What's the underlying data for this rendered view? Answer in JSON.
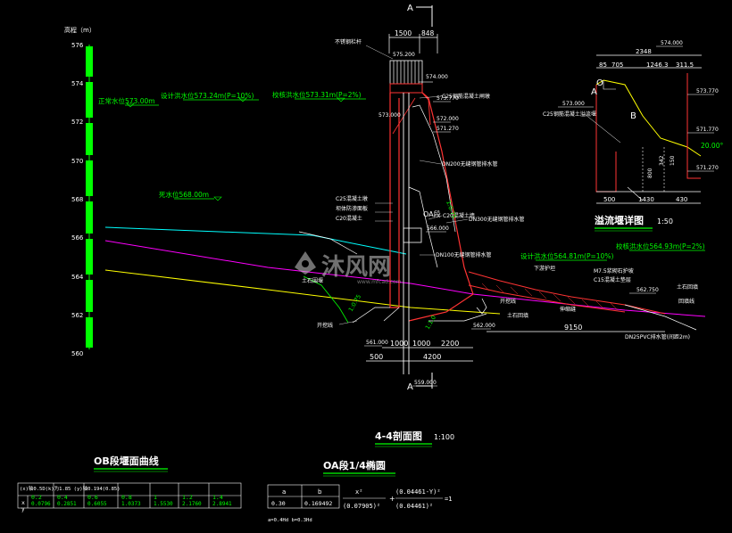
{
  "section_marks": {
    "top": "A",
    "bottom": "A"
  },
  "elevation_scale": {
    "title": "高程（m）",
    "ticks": [
      "576",
      "574",
      "572",
      "570",
      "568",
      "566",
      "564",
      "562",
      "560"
    ]
  },
  "water_levels": {
    "normal": "正常水位573.00m",
    "design": "设计洪水位573.24m(P=10%)",
    "check": "校核洪水位573.31m(P=2%)",
    "dead": "死水位568.00m",
    "design_right": "设计洪水位564.81m(P=10%)",
    "check_right": "校核洪水位564.93m(P=2%)"
  },
  "main_dims": {
    "top_a": "1500",
    "top_b": "848",
    "bottom_a": "1000",
    "bottom_b": "1000",
    "bottom_c": "2200",
    "bottom_d": "500",
    "bottom_e": "4200",
    "bottom_f": "9150"
  },
  "elevations": {
    "e575": "575.200",
    "e574": "574.000",
    "e573a": "573.000",
    "e573b": "573.770",
    "e572": "572.000",
    "e571": "571.270",
    "e566": "566.000",
    "e562a": "562.000",
    "e562b": "562.750",
    "e561": "561.000",
    "e559": "559.000"
  },
  "annotations": {
    "a1": "不锈钢栏杆",
    "a2": "C25钢筋混凝土闸墩",
    "a3": "DN200无缝钢管排水管",
    "a4": "C25混凝土墩",
    "a5": "坝体防渗面板",
    "a6": "C20混凝土",
    "a7": "C20混凝土墙",
    "a8": "OA段",
    "a9": "DN300无缝钢管排水管",
    "a10": "DN100无缝钢管排水管",
    "a11": "土石围堰",
    "a12": "开挖线",
    "a13": "下游护坦",
    "a14": "M7.5浆砌石护坡",
    "a15": "C15混凝土垫层",
    "a16": "开挖线",
    "a17": "伸缩缝",
    "a18": "土石回填",
    "a19": "土石回填",
    "a20": "回填线",
    "a21": "DN25PVC排水管(间距2m)",
    "slope_1": "1:0.75",
    "slope_2": "1:0.75",
    "slope_3": "1:1.0",
    "slope_4": "1:0.5",
    "e_label": "1:1.0"
  },
  "watermark": {
    "logo_text": "沐风网",
    "url": "www.mfcad.com"
  },
  "main_title": {
    "name": "4-4剖面图",
    "scale": "1:100"
  },
  "detail": {
    "title": "溢流堰详图",
    "scale": "1:50",
    "e_top": "574.000",
    "e_right1": "573.770",
    "e_left": "573.000",
    "e_right2": "571.770",
    "e_right3": "571.270",
    "dim_total": "2348",
    "dim_parts": [
      "85",
      "705",
      "1246.3",
      "311.5"
    ],
    "dim_bottom": [
      "500",
      "1430",
      "430"
    ],
    "dim_side": [
      "800",
      "342",
      "150"
    ],
    "angle": "20.00°",
    "point_o": "O",
    "point_a": "A",
    "point_b": "B",
    "note": "C25钢筋混凝土溢流堰"
  },
  "curve_table": {
    "title": "OB段堰面曲线",
    "header_note": "(x)轴0.5D(k)为1.85   (y)轴0.194(0.85)",
    "rows": [
      {
        "label": "x",
        "values": [
          "0.2",
          "0.4",
          "0.6",
          "0.8",
          "1",
          "1.2",
          "1.4"
        ]
      },
      {
        "label": "y",
        "values": [
          "0.0796",
          "0.2851",
          "0.6055",
          "1.0373",
          "1.5530",
          "2.1760",
          "2.8941"
        ]
      }
    ]
  },
  "ellipse_table": {
    "title": "OA段1/4椭圆",
    "headers": [
      "a",
      "b"
    ],
    "values": [
      "0.30",
      "0.169492"
    ],
    "eq_parts": [
      "x²",
      "(0.07905)²",
      "(0.04461-Y)²",
      "(0.04461)²",
      "=1"
    ],
    "note": "a=0.4Hd  b=0.3Hd"
  }
}
